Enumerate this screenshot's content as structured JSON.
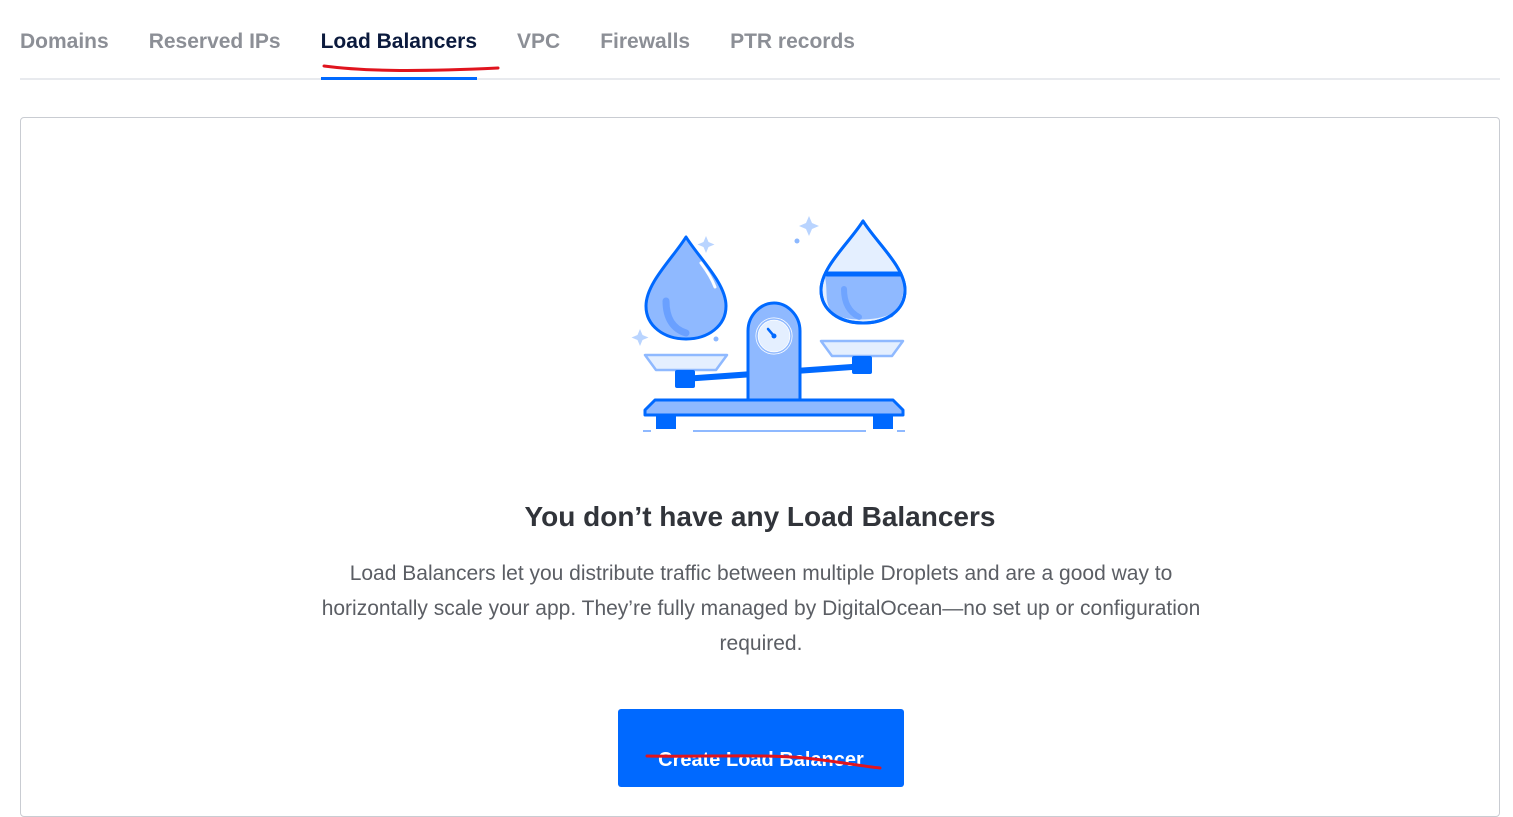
{
  "tabs": [
    {
      "label": "Domains",
      "active": false
    },
    {
      "label": "Reserved IPs",
      "active": false
    },
    {
      "label": "Load Balancers",
      "active": true
    },
    {
      "label": "VPC",
      "active": false
    },
    {
      "label": "Firewalls",
      "active": false
    },
    {
      "label": "PTR records",
      "active": false
    }
  ],
  "empty_state": {
    "title": "You don’t have any Load Balancers",
    "description": "Load Balancers let you distribute traffic between multiple Droplets and are a good way to horizontally scale your app. They’re fully managed by DigitalOcean—no set up or configuration required.",
    "button_label": "Create Load Balancer",
    "illustration_icon": "balance-scale-droplets-icon"
  },
  "colors": {
    "accent": "#0069ff",
    "active_tab_text": "#0b1a3d",
    "inactive_tab_text": "#8c8f96",
    "annotation": "#e0141e"
  }
}
